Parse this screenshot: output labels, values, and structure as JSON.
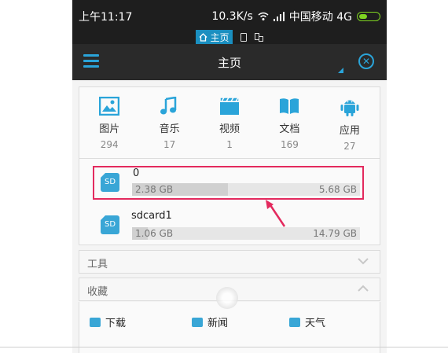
{
  "status": {
    "time": "上午11:17",
    "speed": "10.3K/s",
    "carrier": "中国移动 4G"
  },
  "tabs": {
    "home": "主页"
  },
  "header": {
    "title": "主页"
  },
  "categories": [
    {
      "name": "图片",
      "count": "294",
      "icon": "image-icon"
    },
    {
      "name": "音乐",
      "count": "17",
      "icon": "music-icon"
    },
    {
      "name": "视频",
      "count": "1",
      "icon": "video-icon"
    },
    {
      "name": "文档",
      "count": "169",
      "icon": "book-icon"
    },
    {
      "name": "应用",
      "count": "27",
      "icon": "android-icon"
    }
  ],
  "storage": [
    {
      "name": "0",
      "used": "2.38 GB",
      "total": "5.68 GB",
      "fraction": 0.42
    },
    {
      "name": "sdcard1",
      "used": "1.06 GB",
      "total": "14.79 GB",
      "fraction": 0.07
    }
  ],
  "sd_label": "SD",
  "sections": {
    "tools": "工具",
    "favorites": "收藏"
  },
  "favorites": [
    "下载",
    "新闻",
    "天气"
  ],
  "colors": {
    "accent": "#2aa4d9",
    "highlight": "#e32a5e",
    "battery": "#7ed321"
  }
}
